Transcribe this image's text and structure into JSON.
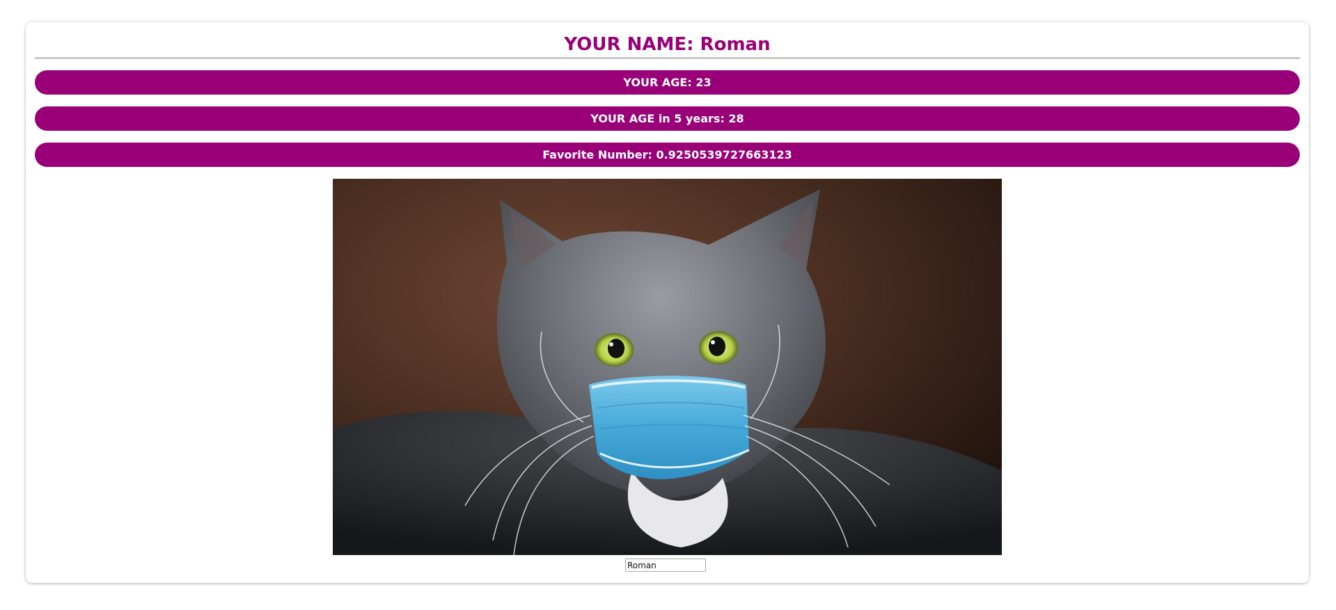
{
  "header": {
    "title": "YOUR NAME: Roman"
  },
  "info": {
    "age": "YOUR AGE: 23",
    "age_future": "YOUR AGE in 5 years: 28",
    "favorite_number": "Favorite Number: 0.9250539727663123"
  },
  "name_input": {
    "value": "Roman"
  },
  "colors": {
    "accent": "#990077",
    "pill_text": "#ffffff",
    "divider": "#c8c8c8"
  }
}
